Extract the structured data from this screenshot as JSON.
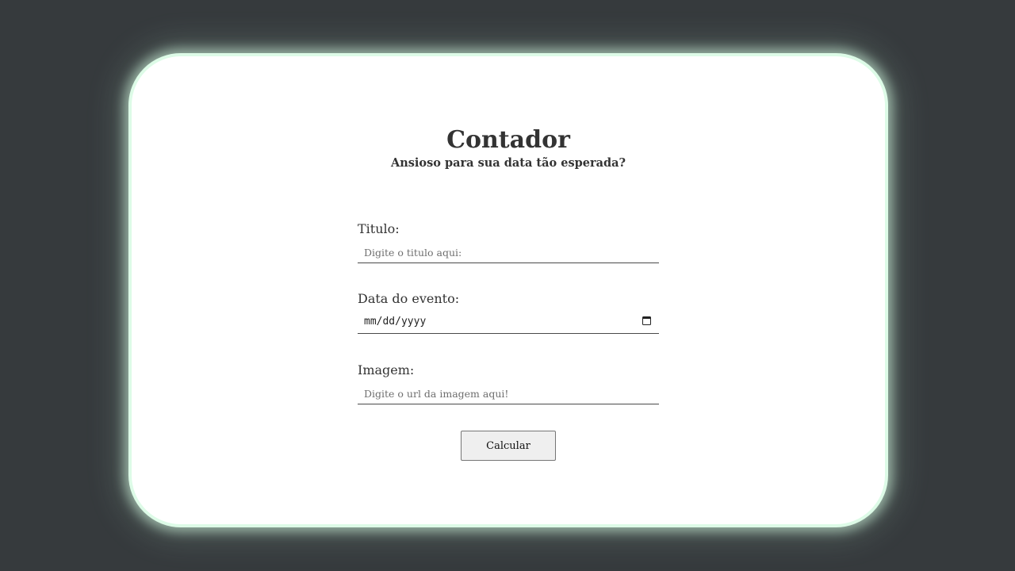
{
  "header": {
    "title": "Contador",
    "subtitle": "Ansioso para sua data tão esperada?"
  },
  "form": {
    "title_field": {
      "label": "Titulo:",
      "placeholder": "Digite o titulo aqui:"
    },
    "date_field": {
      "label": "Data do evento:",
      "placeholder": "mm/dd/yyyy",
      "icon": "calendar-icon"
    },
    "image_field": {
      "label": "Imagem:",
      "placeholder": "Digite o url da imagem aqui!"
    },
    "submit_label": "Calcular"
  },
  "colors": {
    "background": "#363a3d",
    "card": "#ffffff",
    "card_border_glow": "#ddfbe7",
    "text": "#333333"
  }
}
